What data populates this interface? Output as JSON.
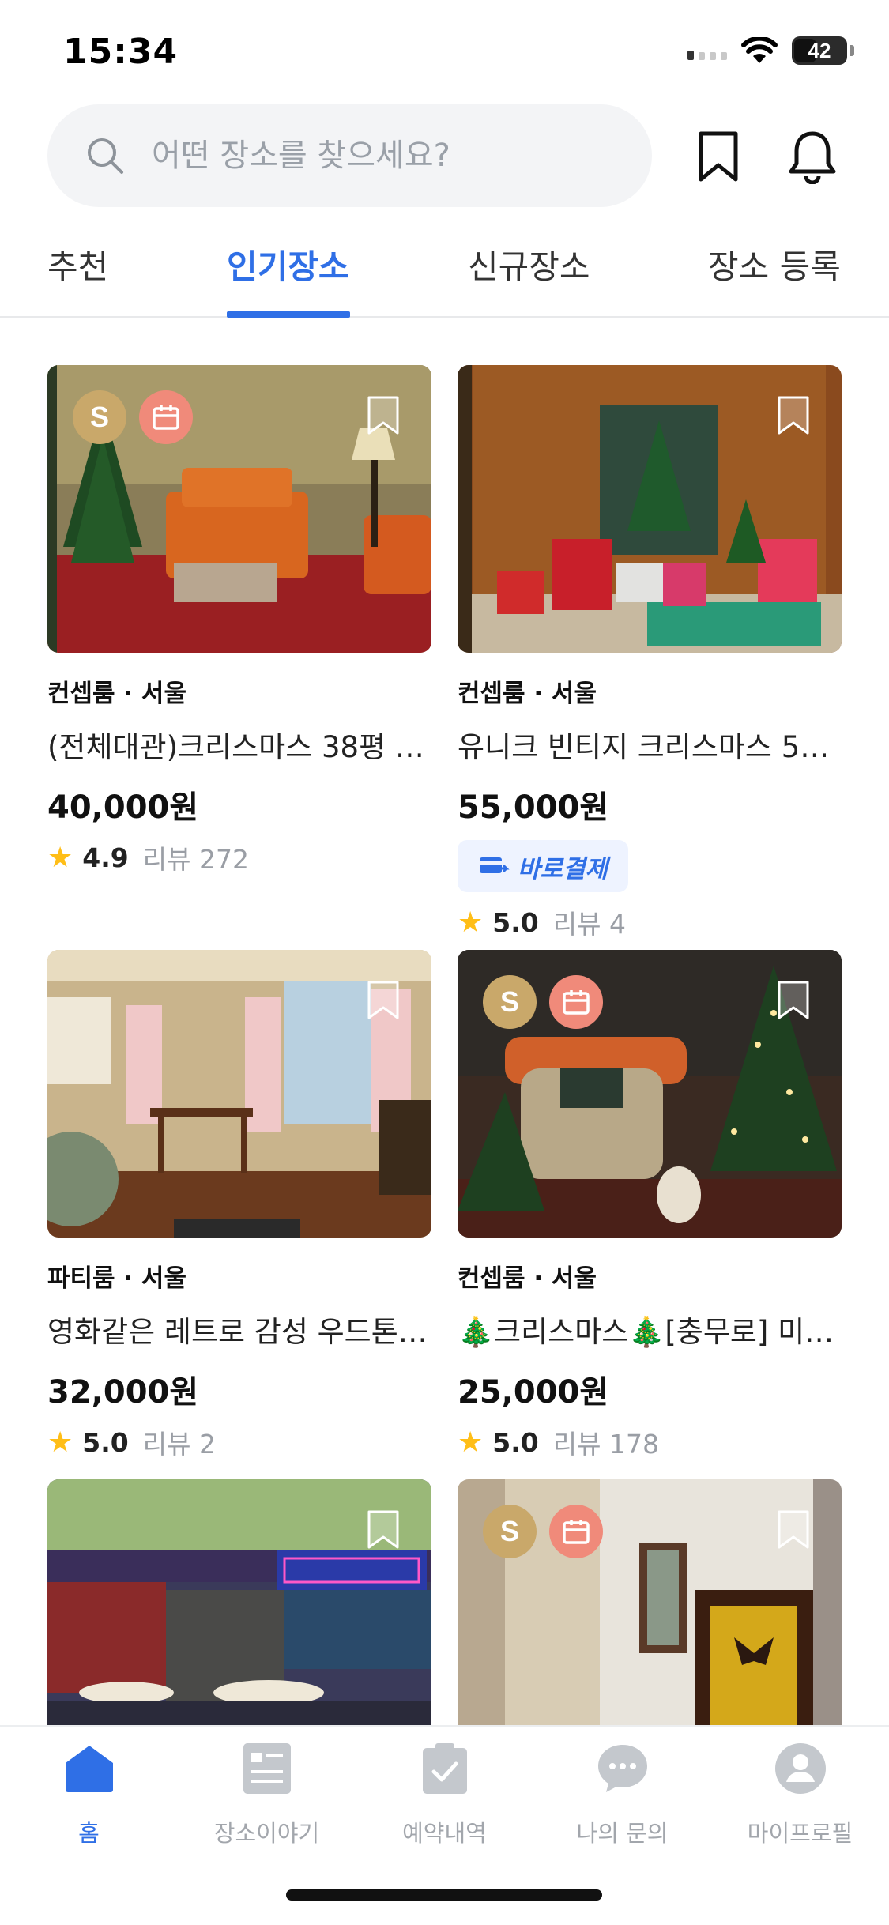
{
  "status": {
    "time": "15:34",
    "battery": "42"
  },
  "search": {
    "placeholder": "어떤 장소를 찾으세요?"
  },
  "tabs": [
    {
      "label": "추천"
    },
    {
      "label": "인기장소",
      "active": true
    },
    {
      "label": "신규장소"
    },
    {
      "label": "장소 등록"
    }
  ],
  "cards": [
    {
      "category": "컨셉룸 · 서울",
      "name": "(전체대관)크리스마스 38평 1…",
      "price": "40,000원",
      "rating": "4.9",
      "reviews": "리뷰 272",
      "badges": [
        "S",
        "calendar"
      ],
      "image": "christmas-living-room-orange-sofa"
    },
    {
      "category": "컨셉룸 · 서울",
      "name": "유니크 빈티지 크리스마스 5…",
      "price": "55,000원",
      "direct_pay": "바로결제",
      "rating": "5.0",
      "reviews": "리뷰 4",
      "image": "vintage-christmas-gifts-tapestry"
    },
    {
      "category": "파티룸 · 서울",
      "name": "영화같은  레트로 감성 우드톤…",
      "price": "32,000원",
      "rating": "5.0",
      "reviews": "리뷰 2",
      "image": "retro-wood-tone-room"
    },
    {
      "category": "컨셉룸 · 서울",
      "name": "🎄크리스마스🎄[충무로] 미…",
      "price": "25,000원",
      "rating": "5.0",
      "reviews": "리뷰 178",
      "badges": [
        "S",
        "calendar"
      ],
      "image": "christmas-armchair-tree"
    },
    {
      "image": "neon-retro-cafe-interior"
    },
    {
      "badges": [
        "S",
        "calendar"
      ],
      "image": "tiled-room-broken-wall"
    }
  ],
  "bottom_nav": [
    {
      "label": "홈",
      "icon": "home-icon",
      "active": true
    },
    {
      "label": "장소이야기",
      "icon": "document-icon"
    },
    {
      "label": "예약내역",
      "icon": "clipboard-check-icon"
    },
    {
      "label": "나의 문의",
      "icon": "chat-bubble-icon"
    },
    {
      "label": "마이프로필",
      "icon": "profile-icon"
    }
  ],
  "colors": {
    "accent": "#2f6fe6",
    "star": "#ffbe17",
    "badge_s": "#c9a86a",
    "badge_calendar": "#f08a7a"
  }
}
